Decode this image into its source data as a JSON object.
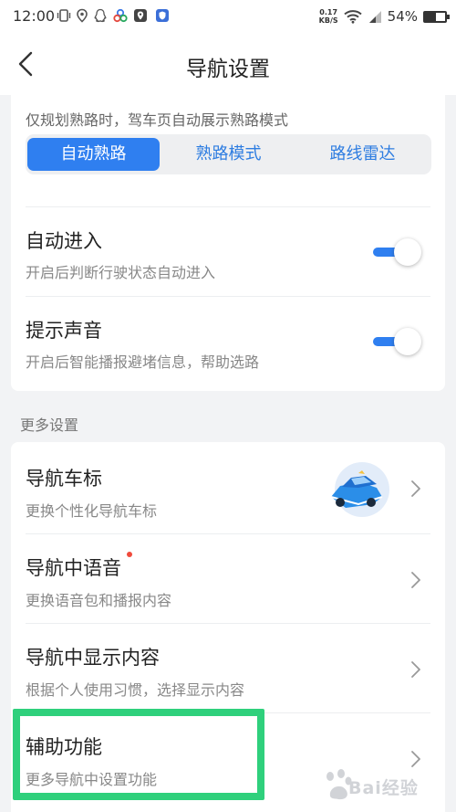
{
  "status_bar": {
    "time": "12:00",
    "net_speed_value": "0.17",
    "net_speed_unit": "KB/S",
    "battery_percent": "54%",
    "battery_level": 0.54,
    "icons": [
      "vibrate-icon",
      "location-icon",
      "qq-icon",
      "cloud-icon",
      "map-app-icon",
      "shield-icon",
      "wifi-icon",
      "signal-icon",
      "battery-icon"
    ]
  },
  "header": {
    "title": "导航设置",
    "back_icon": "chevron-left-icon"
  },
  "route_mode": {
    "hint": "仅规划熟路时，驾车页自动展示熟路模式",
    "options": [
      "自动熟路",
      "熟路模式",
      "路线雷达"
    ],
    "selected": "自动熟路"
  },
  "toggles": [
    {
      "title": "自动进入",
      "subtitle": "开启后判断行驶状态自动进入",
      "on": true
    },
    {
      "title": "提示声音",
      "subtitle": "开启后智能播报避堵信息，帮助选路",
      "on": true
    }
  ],
  "more_settings": {
    "section_label": "更多设置",
    "items": [
      {
        "title": "导航车标",
        "subtitle": "更换个性化导航车标",
        "thumbnail": "blue-car-icon"
      },
      {
        "title": "导航中语音",
        "subtitle": "更换语音包和播报内容",
        "badge": "red-dot"
      },
      {
        "title": "导航中显示内容",
        "subtitle": "根据个人使用习惯，选择显示内容"
      },
      {
        "title": "辅助功能",
        "subtitle": "更多导航中设置功能",
        "highlighted": true
      }
    ]
  },
  "colors": {
    "accent": "#2f7ff0",
    "highlight_box": "#2fd07c",
    "badge": "#f04a3c",
    "background": "#f2f3f5"
  },
  "watermark": {
    "text": "Bai经验"
  }
}
